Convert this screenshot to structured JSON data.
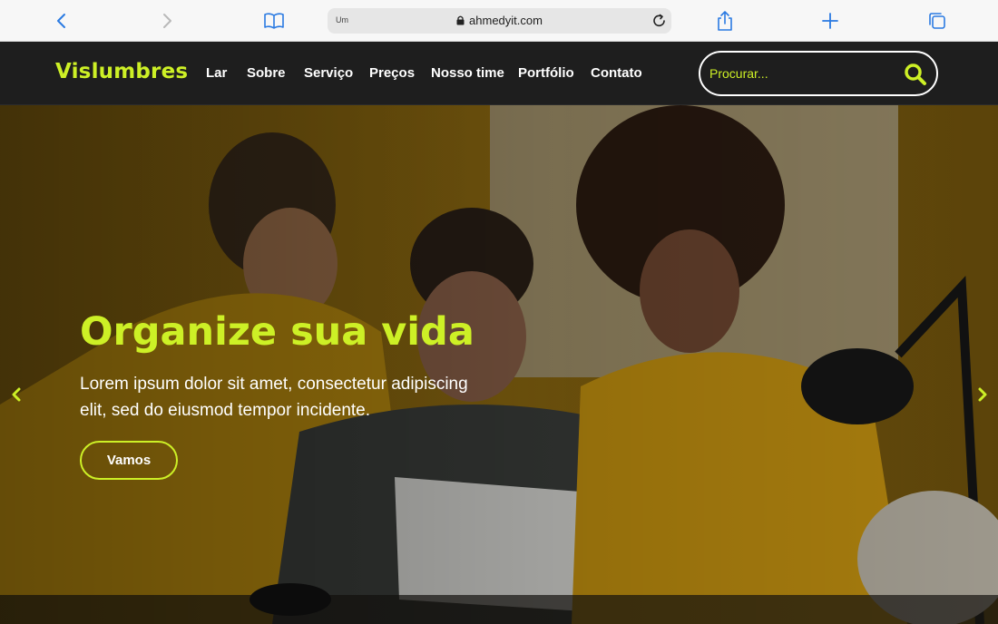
{
  "browser": {
    "address_left": "Um",
    "url": "ahmedyit.com",
    "icons": [
      "back-chevron-icon",
      "forward-chevron-icon",
      "book-icon",
      "lock-icon",
      "reload-icon",
      "share-icon",
      "plus-icon",
      "tabs-icon"
    ]
  },
  "header": {
    "logo": "Vislumbres",
    "nav": [
      "Lar",
      "Sobre",
      "Serviço",
      "Preços",
      "Nosso time",
      "Portfólio",
      "Contato"
    ],
    "search_placeholder": "Procurar...",
    "search_icon": "search-icon"
  },
  "hero": {
    "title": "Organize sua vida",
    "text": "Lorem ipsum dolor sit amet, consectetur adipiscing elit, sed do eiusmod tempor incidente.",
    "button": "Vamos",
    "prev_icon": "chevron-left-icon",
    "next_icon": "chevron-right-icon"
  },
  "colors": {
    "accent": "#cdf026",
    "header_bg": "#1e1e1e",
    "browser_bar": "#f7f7f7"
  }
}
